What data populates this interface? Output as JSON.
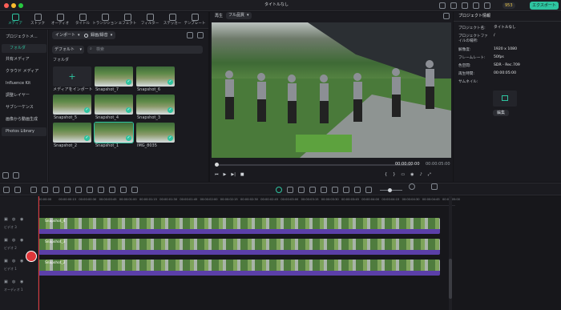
{
  "window": {
    "title": "タイトルなし",
    "export_label": "エクスポート",
    "credits": "953"
  },
  "media_tabs": [
    {
      "label": "メディア"
    },
    {
      "label": "ストック"
    },
    {
      "label": "オーディオ"
    },
    {
      "label": "タイトル"
    },
    {
      "label": "トランジション"
    },
    {
      "label": "エフェクト"
    },
    {
      "label": "フィルター"
    },
    {
      "label": "ステッカー"
    },
    {
      "label": "テンプレート"
    }
  ],
  "sidebar": {
    "items": [
      {
        "label": "プロジェクトメ..."
      },
      {
        "label": "フォルダ"
      },
      {
        "label": "共有メディア"
      },
      {
        "label": "クラウド メディア"
      },
      {
        "label": "Influence Kit"
      },
      {
        "label": "調整レイヤー"
      },
      {
        "label": "サブシーケンス"
      },
      {
        "label": "画像から動画生成"
      },
      {
        "label": "Photos Library"
      }
    ]
  },
  "library": {
    "import_label": "インポート",
    "record_label": "録画/録音",
    "sort_label": "デフォルト",
    "search_placeholder": "検索",
    "folder_label": "フォルダ",
    "items": [
      {
        "name": "メディアをインポート"
      },
      {
        "name": "Snapshot_7"
      },
      {
        "name": "Snapshot_6"
      },
      {
        "name": "Snapshot_5"
      },
      {
        "name": "Snapshot_4"
      },
      {
        "name": "Snapshot_3"
      },
      {
        "name": "Snapshot_2"
      },
      {
        "name": "Snapshot_1"
      },
      {
        "name": "IMG_8035"
      }
    ]
  },
  "player": {
    "label": "再生",
    "quality": "フル品質",
    "time_current": "00:00:00:00",
    "time_total": "00:00:05:00"
  },
  "properties": {
    "tab": "プロジェクト情報",
    "rows": [
      {
        "key": "プロジェクト名:",
        "value": "タイトルなし"
      },
      {
        "key": "プロジェクトファイルの場所:",
        "value": "/"
      },
      {
        "key": "解像度:",
        "value": "1920 x 1080"
      },
      {
        "key": "フレームレート:",
        "value": "50fps"
      },
      {
        "key": "色空間:",
        "value": "SDR - Rec.709"
      },
      {
        "key": "再生時間:",
        "value": "00:00:05:00"
      },
      {
        "key": "サムネイル:",
        "value": ""
      }
    ],
    "edit_label": "編集"
  },
  "timeline": {
    "ruler": [
      "00:00:00",
      "00:00:00:15",
      "00:00:00:30",
      "00:00:00:45",
      "00:00:01:00",
      "00:00:01:15",
      "00:00:01:30",
      "00:00:01:45",
      "00:00:02:00",
      "00:00:02:15",
      "00:00:02:30",
      "00:00:02:45",
      "00:00:03:00",
      "00:00:03:15",
      "00:00:03:30",
      "00:00:03:45",
      "00:00:04:00",
      "00:00:04:15",
      "00:00:04:30",
      "00:00:04:45",
      "00:00:05:00"
    ],
    "tracks": [
      {
        "label": "ビデオ 3",
        "clip": "Snapshot_4"
      },
      {
        "label": "ビデオ 2",
        "clip": "Snapshot_3"
      },
      {
        "label": "ビデオ 1",
        "clip": "Snapshot_2"
      },
      {
        "label": "オーディオ 1",
        "clip": ""
      }
    ]
  },
  "colors": {
    "accent": "#2ec4a0",
    "clip": "#5b3fa8",
    "playhead": "#e0363a"
  }
}
